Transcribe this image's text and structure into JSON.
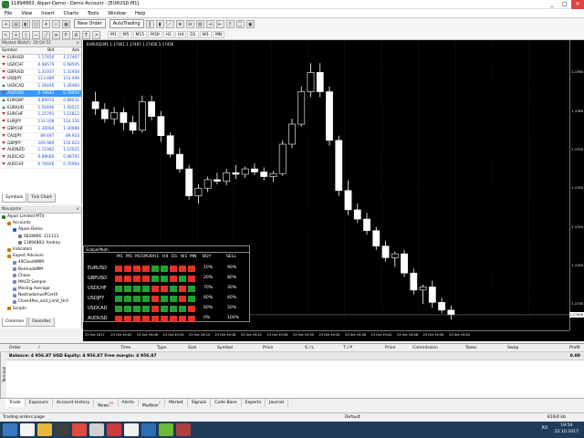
{
  "window": {
    "title": "11894883: Alpari-Demo - Demo Account - [EURUSD,M1]",
    "btn_min": "_",
    "btn_max": "□",
    "btn_close": "✕"
  },
  "menu": [
    "File",
    "View",
    "Insert",
    "Charts",
    "Tools",
    "Window",
    "Help"
  ],
  "toolbar": {
    "new_order": "New Order",
    "autotrading": "AutoTrading",
    "timeframes": [
      "M1",
      "M5",
      "M15",
      "M30",
      "H1",
      "H4",
      "D1",
      "W1",
      "MN"
    ]
  },
  "market_watch": {
    "title": "Market Watch: 19:54:51",
    "columns": [
      "Symbol",
      "Bid",
      "Ask"
    ],
    "rows": [
      {
        "symbol": "EURUSD",
        "bid": "1.17456",
        "ask": "1.17467",
        "dir": "down"
      },
      {
        "symbol": "USDCHF",
        "bid": "0.98579",
        "ask": "0.98595",
        "dir": "down"
      },
      {
        "symbol": "GBPUSD",
        "bid": "1.31937",
        "ask": "1.31958",
        "dir": "down"
      },
      {
        "symbol": "USDJPY",
        "bid": "113.489",
        "ask": "113.496",
        "dir": "down"
      },
      {
        "symbol": "USDCAD",
        "bid": "1.26446",
        "ask": "1.26460",
        "dir": "up"
      },
      {
        "symbol": "AUDUSD",
        "bid": "0.78042",
        "ask": "0.78054",
        "dir": "down",
        "selected": true
      },
      {
        "symbol": "EURGBP",
        "bid": "0.89015",
        "ask": "0.89031",
        "dir": "up"
      },
      {
        "symbol": "EURAUD",
        "bid": "1.50496",
        "ask": "1.50511",
        "dir": "up"
      },
      {
        "symbol": "EURCHF",
        "bid": "1.15791",
        "ask": "1.15812",
        "dir": "down"
      },
      {
        "symbol": "EURJPY",
        "bid": "133.338",
        "ask": "133.350",
        "dir": "down"
      },
      {
        "symbol": "GBPCHF",
        "bid": "1.30060",
        "ask": "1.30088",
        "dir": "down"
      },
      {
        "symbol": "CADJPY",
        "bid": "89.697",
        "ask": "89.924",
        "dir": "down"
      },
      {
        "symbol": "GBPJPY",
        "bid": "169.989",
        "ask": "150.023",
        "dir": "down"
      },
      {
        "symbol": "AUDNZD",
        "bid": "1.11982",
        "ask": "1.12025",
        "dir": "down"
      },
      {
        "symbol": "AUDCAD",
        "bid": "0.98680",
        "ask": "0.98795",
        "dir": "down"
      },
      {
        "symbol": "AUDCHF",
        "bid": "0.76926",
        "ask": "0.76964",
        "dir": "down"
      }
    ],
    "tabs": [
      "Symbols",
      "Tick Chart"
    ]
  },
  "navigator": {
    "title": "Navigator",
    "items": [
      {
        "label": "Alpari Limited MT4",
        "level": 0,
        "color": "#2e7d32"
      },
      {
        "label": "Accounts",
        "level": 1,
        "color": "#c27c0e"
      },
      {
        "label": "Alpari-Demo",
        "level": 2,
        "color": "#1565c0"
      },
      {
        "label": "6828966: 111111",
        "level": 3,
        "color": "#7b7b7b"
      },
      {
        "label": "11894883: Andrey",
        "level": 3,
        "color": "#7b7b7b"
      },
      {
        "label": "Indicators",
        "level": 1,
        "color": "#c27c0e"
      },
      {
        "label": "Expert Advisors",
        "level": 1,
        "color": "#c27c0e"
      },
      {
        "label": "4XCloud4MM",
        "level": 2,
        "color": "#7986cb"
      },
      {
        "label": "BermudaMM",
        "level": 2,
        "color": "#7986cb"
      },
      {
        "label": "Chaos",
        "level": 2,
        "color": "#7986cb"
      },
      {
        "label": "MACD Sample",
        "level": 2,
        "color": "#7986cb"
      },
      {
        "label": "Moving Average",
        "level": 2,
        "color": "#7986cb"
      },
      {
        "label": "NostradamusPCert4",
        "level": 2,
        "color": "#7986cb"
      },
      {
        "label": "Close4Pos_and_Limit_Ord",
        "level": 2,
        "color": "#7986cb"
      },
      {
        "label": "Scripts",
        "level": 1,
        "color": "#c27c0e"
      }
    ],
    "tabs": [
      "Common",
      "Favorites"
    ]
  },
  "chart": {
    "info": "EURUSD,M1  1.17461 1.17467 1.17456 1.17456",
    "price_ticks": [
      "1.1765",
      "1.1760",
      "1.1755",
      "1.1750",
      "1.1745",
      "1.1740",
      "1.1735"
    ],
    "current_price": "1.17456",
    "time_ticks": [
      "23 Oct 2017",
      "23 Oct 19:02",
      "23 Oct 19:06",
      "23 Oct 19:10",
      "23 Oct 19:14",
      "23 Oct 19:18",
      "23 Oct 19:22",
      "23 Oct 19:26",
      "23 Oct 19:30",
      "23 Oct 19:34",
      "23 Oct 19:38",
      "23 Oct 19:42",
      "23 Oct 19:46",
      "23 Oct 19:50",
      "23 Oct 19:54"
    ],
    "chart_data": {
      "type": "candlestick",
      "symbol": "EURUSD",
      "timeframe": "M1",
      "ylim": [
        1.1733,
        1.1768
      ],
      "candles": [
        {
          "o": 1.17612,
          "h": 1.17625,
          "l": 1.17595,
          "c": 1.17603
        },
        {
          "o": 1.17602,
          "h": 1.1761,
          "l": 1.17585,
          "c": 1.1759
        },
        {
          "o": 1.1759,
          "h": 1.17605,
          "l": 1.17582,
          "c": 1.17598
        },
        {
          "o": 1.17598,
          "h": 1.17604,
          "l": 1.17575,
          "c": 1.17585
        },
        {
          "o": 1.17585,
          "h": 1.17594,
          "l": 1.1757,
          "c": 1.17575
        },
        {
          "o": 1.17575,
          "h": 1.1762,
          "l": 1.17572,
          "c": 1.17612
        },
        {
          "o": 1.17612,
          "h": 1.1762,
          "l": 1.17588,
          "c": 1.17593
        },
        {
          "o": 1.17593,
          "h": 1.176,
          "l": 1.1756,
          "c": 1.17568
        },
        {
          "o": 1.17568,
          "h": 1.17572,
          "l": 1.1754,
          "c": 1.17544
        },
        {
          "o": 1.17544,
          "h": 1.17552,
          "l": 1.1752,
          "c": 1.17525
        },
        {
          "o": 1.17525,
          "h": 1.1753,
          "l": 1.17485,
          "c": 1.1749
        },
        {
          "o": 1.1749,
          "h": 1.17505,
          "l": 1.1748,
          "c": 1.175
        },
        {
          "o": 1.175,
          "h": 1.17515,
          "l": 1.17495,
          "c": 1.17511
        },
        {
          "o": 1.17511,
          "h": 1.1752,
          "l": 1.17505,
          "c": 1.17509
        },
        {
          "o": 1.17509,
          "h": 1.17525,
          "l": 1.17504,
          "c": 1.1752
        },
        {
          "o": 1.1752,
          "h": 1.1753,
          "l": 1.17512,
          "c": 1.17518
        },
        {
          "o": 1.17518,
          "h": 1.17528,
          "l": 1.17513,
          "c": 1.17525
        },
        {
          "o": 1.17525,
          "h": 1.17532,
          "l": 1.17517,
          "c": 1.17521
        },
        {
          "o": 1.17521,
          "h": 1.17527,
          "l": 1.1751,
          "c": 1.17515
        },
        {
          "o": 1.17515,
          "h": 1.17522,
          "l": 1.17508,
          "c": 1.17519
        },
        {
          "o": 1.17519,
          "h": 1.17562,
          "l": 1.17516,
          "c": 1.17557
        },
        {
          "o": 1.17557,
          "h": 1.1759,
          "l": 1.17552,
          "c": 1.17583
        },
        {
          "o": 1.17583,
          "h": 1.17632,
          "l": 1.1758,
          "c": 1.17625
        },
        {
          "o": 1.17625,
          "h": 1.17662,
          "l": 1.17618,
          "c": 1.1765
        },
        {
          "o": 1.1765,
          "h": 1.17662,
          "l": 1.17618,
          "c": 1.17625
        },
        {
          "o": 1.17625,
          "h": 1.17632,
          "l": 1.17555,
          "c": 1.17562
        },
        {
          "o": 1.17562,
          "h": 1.17568,
          "l": 1.1749,
          "c": 1.17497
        },
        {
          "o": 1.17497,
          "h": 1.1751,
          "l": 1.17465,
          "c": 1.17472
        },
        {
          "o": 1.17472,
          "h": 1.1748,
          "l": 1.17455,
          "c": 1.1746
        },
        {
          "o": 1.1746,
          "h": 1.17468,
          "l": 1.1744,
          "c": 1.17445
        },
        {
          "o": 1.17445,
          "h": 1.1745,
          "l": 1.1742,
          "c": 1.17425
        },
        {
          "o": 1.17425,
          "h": 1.17432,
          "l": 1.17405,
          "c": 1.1741
        },
        {
          "o": 1.1741,
          "h": 1.17418,
          "l": 1.17398,
          "c": 1.17415
        },
        {
          "o": 1.17415,
          "h": 1.1742,
          "l": 1.17385,
          "c": 1.1739
        },
        {
          "o": 1.1739,
          "h": 1.17396,
          "l": 1.17362,
          "c": 1.17368
        },
        {
          "o": 1.17368,
          "h": 1.17375,
          "l": 1.1735,
          "c": 1.17372
        },
        {
          "o": 1.17372,
          "h": 1.1738,
          "l": 1.17345,
          "c": 1.17352
        },
        {
          "o": 1.17352,
          "h": 1.17358,
          "l": 1.17338,
          "c": 1.17342
        },
        {
          "o": 1.17342,
          "h": 1.17348,
          "l": 1.1733,
          "c": 1.17336
        }
      ]
    }
  },
  "scalper": {
    "title": "ScalperMulti",
    "timeframes": [
      "M1",
      "M5",
      "M15",
      "M30",
      "H1",
      "H4",
      "D1",
      "W1",
      "MN"
    ],
    "buy_label": "BUY",
    "sell_label": "SELL",
    "rows": [
      {
        "symbol": "EURUSD",
        "signals": [
          "r",
          "r",
          "r",
          "r",
          "g",
          "g",
          "r",
          "r",
          "r"
        ],
        "buy": "10%",
        "sell": "90%"
      },
      {
        "symbol": "GBPUSD",
        "signals": [
          "r",
          "r",
          "r",
          "r",
          "g",
          "g",
          "r",
          "g",
          "r"
        ],
        "buy": "20%",
        "sell": "80%"
      },
      {
        "symbol": "USDCHF",
        "signals": [
          "g",
          "g",
          "g",
          "g",
          "r",
          "r",
          "g",
          "r",
          "g"
        ],
        "buy": "70%",
        "sell": "30%"
      },
      {
        "symbol": "USDJPY",
        "signals": [
          "g",
          "g",
          "g",
          "g",
          "r",
          "g",
          "g",
          "r",
          "g"
        ],
        "buy": "60%",
        "sell": "40%"
      },
      {
        "symbol": "USDCAD",
        "signals": [
          "g",
          "g",
          "g",
          "g",
          "r",
          "g",
          "g",
          "g",
          "r"
        ],
        "buy": "60%",
        "sell": "20%"
      },
      {
        "symbol": "AUDUSD",
        "signals": [
          "r",
          "r",
          "r",
          "r",
          "r",
          "r",
          "r",
          "r",
          "r"
        ],
        "buy": "0%",
        "sell": "100%"
      }
    ]
  },
  "terminal": {
    "columns": [
      "Order",
      "/",
      "Time",
      "Type",
      "Size",
      "Symbol",
      "Price",
      "S / L",
      "T / P",
      "Price",
      "Commission",
      "Taxes",
      "Swap",
      "Profit"
    ],
    "balance": "Balance: 4 956.87 USD  Equity: 4 956.87  Free margin: 4 956.87",
    "balance_profit": "0.00",
    "tabs": [
      "Trade",
      "Exposure",
      "Account History",
      "News",
      "Alerts",
      "Mailbox",
      "Market",
      "Signals",
      "Code Base",
      "Experts",
      "Journal"
    ],
    "news_badge": "99",
    "mailbox_badge": "7",
    "side_label": "Terminal"
  },
  "status": {
    "left": "Trading orders page",
    "mid": "Default",
    "right": "816/4 kb"
  },
  "taskbar": {
    "lang": "RU",
    "time": "19:54",
    "date": "23.10.2017"
  }
}
